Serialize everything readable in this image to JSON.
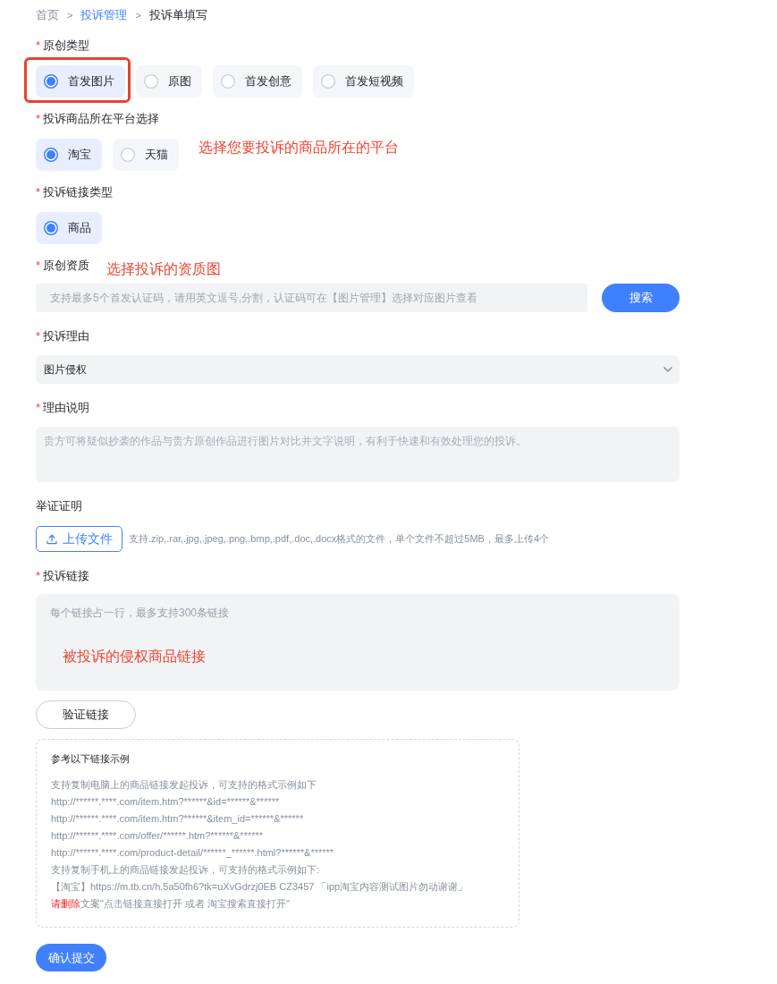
{
  "breadcrumb": [
    {
      "text": "首页",
      "kind": "plain"
    },
    {
      "text": ">",
      "kind": "separator"
    },
    {
      "text": "投诉管理",
      "kind": "link"
    },
    {
      "text": ">",
      "kind": "separator"
    },
    {
      "text": "投诉单填写",
      "kind": "current"
    }
  ],
  "sections": [
    {
      "kind": "radio",
      "marker": "*",
      "label": "原创类型",
      "options": [
        {
          "label": "首发图片",
          "selected": true,
          "highlighted": true
        },
        {
          "label": "原图",
          "selected": false,
          "highlighted": false
        },
        {
          "label": "首发创意",
          "selected": false,
          "highlighted": false
        },
        {
          "label": "首发短视频",
          "selected": false,
          "highlighted": false
        }
      ]
    },
    {
      "kind": "radio",
      "marker": "*",
      "label": "投诉商品所在平台选择",
      "options": [
        {
          "label": "淘宝",
          "selected": true,
          "highlighted": false
        },
        {
          "label": "天猫",
          "selected": false,
          "highlighted": false
        }
      ],
      "annotation": "选择您要投诉的商品所在的平台"
    },
    {
      "kind": "radio",
      "marker": "*",
      "label": "投诉链接类型",
      "options": [
        {
          "label": "商品",
          "selected": true,
          "highlighted": false
        }
      ]
    },
    {
      "kind": "search",
      "marker": "*",
      "label": "原创资质",
      "annotation": "选择投诉的资质图",
      "placeholder": "支持最多5个首发认证码，请用英文逗号,分割，认证码可在【图片管理】选择对应图片查看",
      "button": "搜索"
    },
    {
      "kind": "select",
      "marker": "*",
      "label": "投诉理由",
      "value": "图片侵权"
    },
    {
      "kind": "textarea",
      "marker": "*",
      "label": "理由说明",
      "placeholder": "贵方可将疑似抄袭的作品与贵方原创作品进行图片对比并文字说明，有利于快速和有效处理您的投诉。"
    },
    {
      "kind": "upload",
      "label": "举证证明",
      "button": "上传文件",
      "hint": "支持.zip,.rar,.jpg,.jpeg,.png,.bmp,.pdf,.doc,.docx格式的文件，单个文件不超过5MB，最多上传4个"
    },
    {
      "kind": "links",
      "marker": "*",
      "label": "投诉链接",
      "placeholder": "每个链接占一行，最多支持300条链接",
      "annotation": "被投诉的侵权商品链接",
      "button": "验证链接",
      "example": {
        "title": "参考以下链接示例",
        "lines": [
          "支持复制电脑上的商品链接发起投诉，可支持的格式示例如下",
          "http://******.****.com/item.htm?******&id=******&******",
          "http://******.****.com/item.htm?******&item_id=******&******",
          "http://******.****.com/offer/******.htm?******&******",
          "http://******.****.com/product-detail/******_******.html?******&******",
          "支持复制手机上的商品链接发起投诉，可支持的格式示例如下:",
          "【淘宝】https://m.tb.cn/h.5a50fh6?tk=uXvGdrzj0EB CZ3457 「ipp淘宝内容测试图片勿动谢谢」"
        ],
        "note": {
          "emphasis": "请删除",
          "text": "文案\"点击链接直接打开 或者 淘宝搜索直接打开\""
        }
      }
    }
  ],
  "submit": "确认提交"
}
